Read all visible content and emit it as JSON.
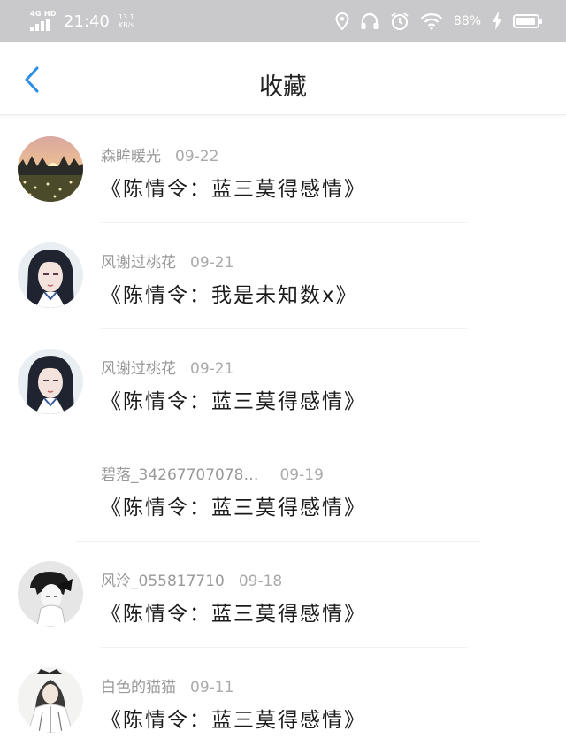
{
  "status_bar": {
    "network": "4G HD",
    "time": "21:40",
    "speed_value": "13.1",
    "speed_unit": "KB/s",
    "battery": "88%"
  },
  "header": {
    "title": "收藏"
  },
  "colors": {
    "accent": "#2b8fe6",
    "status_bar_bg": "#c9c9cb"
  },
  "items": [
    {
      "username": "森眸暖光",
      "date": "09-22",
      "title": "《陈情令：蓝三莫得感情》",
      "avatar": "sunset-field"
    },
    {
      "username": "风谢过桃花",
      "date": "09-21",
      "title": "《陈情令：我是未知数x》",
      "avatar": "anime-portrait"
    },
    {
      "username": "风谢过桃花",
      "date": "09-21",
      "title": "《陈情令：蓝三莫得感情》",
      "avatar": "anime-portrait"
    },
    {
      "username": "碧落_34267707078…",
      "date": "09-19",
      "title": "《陈情令：蓝三莫得感情》",
      "avatar": "none"
    },
    {
      "username": "风泠_055817710",
      "date": "09-18",
      "title": "《陈情令：蓝三莫得感情》",
      "avatar": "sketch-portrait"
    },
    {
      "username": "白色的猫猫",
      "date": "09-11",
      "title": "《陈情令：蓝三莫得感情》",
      "avatar": "ink-portrait"
    }
  ]
}
